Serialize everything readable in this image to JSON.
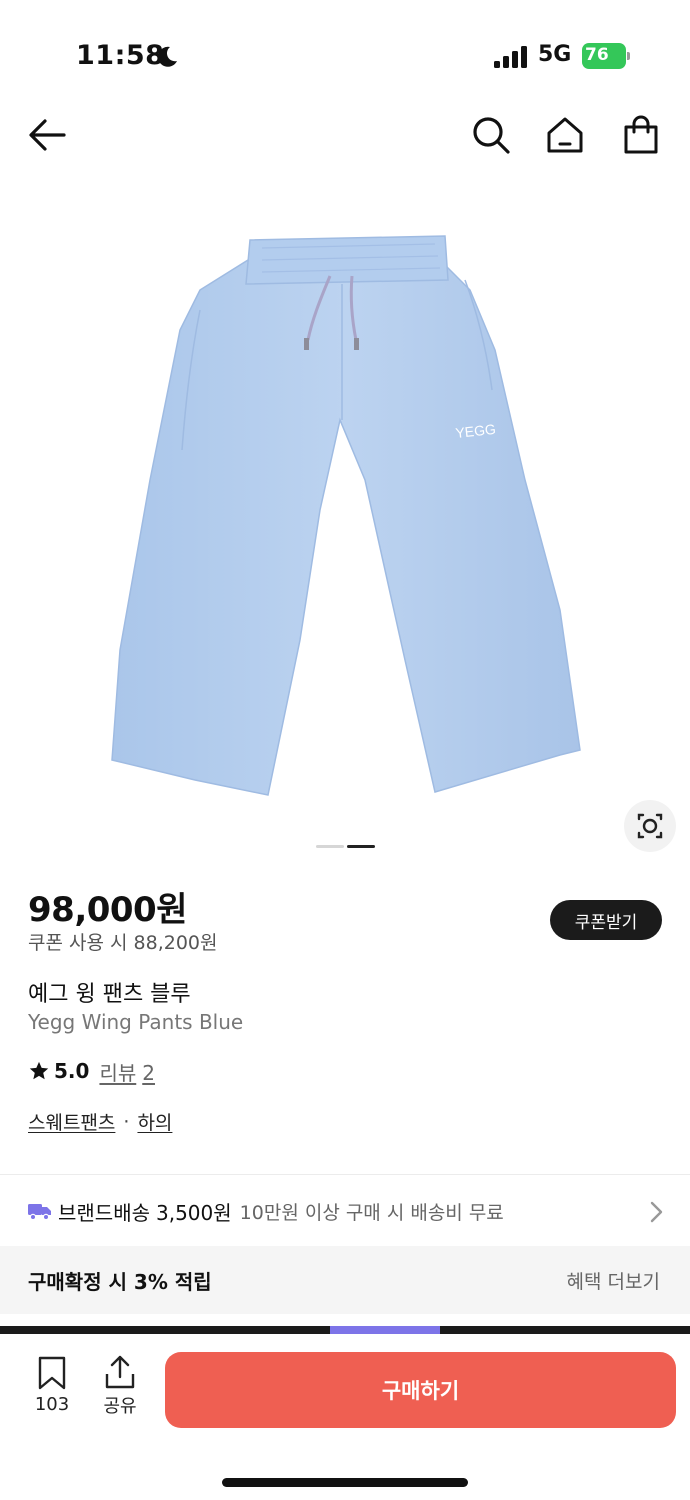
{
  "status_bar": {
    "time": "11:58",
    "network": "5G",
    "battery": "76"
  },
  "nav": {
    "icons": [
      "arrow-left-icon",
      "search-icon",
      "home-icon",
      "shopping-bag-icon"
    ]
  },
  "product": {
    "image_logo_text": "YEGG",
    "image_color": "#b8d0ef",
    "pager": {
      "total": 2,
      "active": 2
    },
    "price": "98,000원",
    "coupon_price": "쿠폰 사용 시 88,200원",
    "coupon_button": "쿠폰받기",
    "name_ko": "예그 윙 팬츠 블루",
    "name_en": "Yegg Wing Pants Blue",
    "rating": "5.0",
    "review_label": "리뷰",
    "review_count": "2",
    "category_1": "스웨트팬츠",
    "category_sep": "·",
    "category_2": "하의"
  },
  "shipping": {
    "label": "브랜드배송",
    "fee": "3,500원",
    "note": "10만원 이상 구매 시 배송비 무료"
  },
  "reward": {
    "text": "구매확정 시 3% 적립",
    "link": "혜택 더보기"
  },
  "bottom_bar": {
    "like_count": "103",
    "share_label": "공유",
    "buy_label": "구매하기"
  },
  "colors": {
    "buy_button": "#ef5f52",
    "battery": "#34c759",
    "truck_icon": "#7d74e8"
  }
}
